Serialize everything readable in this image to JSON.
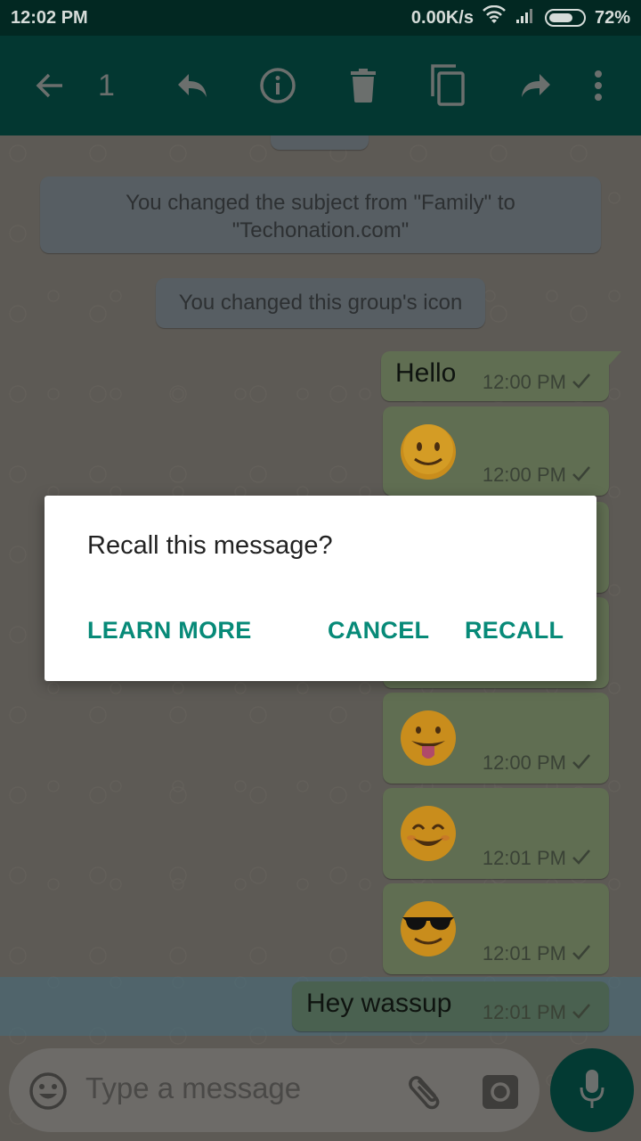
{
  "status_bar": {
    "time": "12:02 PM",
    "network_speed": "0.00K/s",
    "battery_percent": "72%",
    "battery_level": 0.72
  },
  "toolbar": {
    "selected_count": "1",
    "icons": [
      "back-arrow-icon",
      "reply-icon",
      "info-icon",
      "delete-icon",
      "copy-icon",
      "forward-icon",
      "more-vert-icon"
    ]
  },
  "chat": {
    "system_messages": [
      {
        "text": "You changed the subject from \"Family\" to \"Techonation.com\""
      },
      {
        "text": "You changed this group's icon"
      }
    ],
    "messages": [
      {
        "type": "text",
        "text": "Hello",
        "time": "12:00 PM",
        "status": "sent"
      },
      {
        "type": "emoji",
        "emoji": "slightly-smiling-face",
        "time": "12:00 PM",
        "status": "sent"
      },
      {
        "type": "emoji",
        "emoji": "hidden",
        "time": "",
        "status": "sent"
      },
      {
        "type": "emoji",
        "emoji": "hidden",
        "time": "",
        "status": "sent"
      },
      {
        "type": "emoji",
        "emoji": "face-with-tongue",
        "time": "12:00 PM",
        "status": "sent"
      },
      {
        "type": "emoji",
        "emoji": "smiling-face-with-smiling-eyes",
        "time": "12:01 PM",
        "status": "sent"
      },
      {
        "type": "emoji",
        "emoji": "smiling-face-with-sunglasses",
        "time": "12:01 PM",
        "status": "sent"
      },
      {
        "type": "text",
        "text": "Hey wassup",
        "time": "12:01 PM",
        "status": "sent",
        "selected": true
      }
    ]
  },
  "dialog": {
    "title": "Recall this message?",
    "learn_more": "LEARN MORE",
    "cancel": "CANCEL",
    "recall": "RECALL",
    "accent_color": "#078a78"
  },
  "composer": {
    "placeholder": "Type a message"
  }
}
